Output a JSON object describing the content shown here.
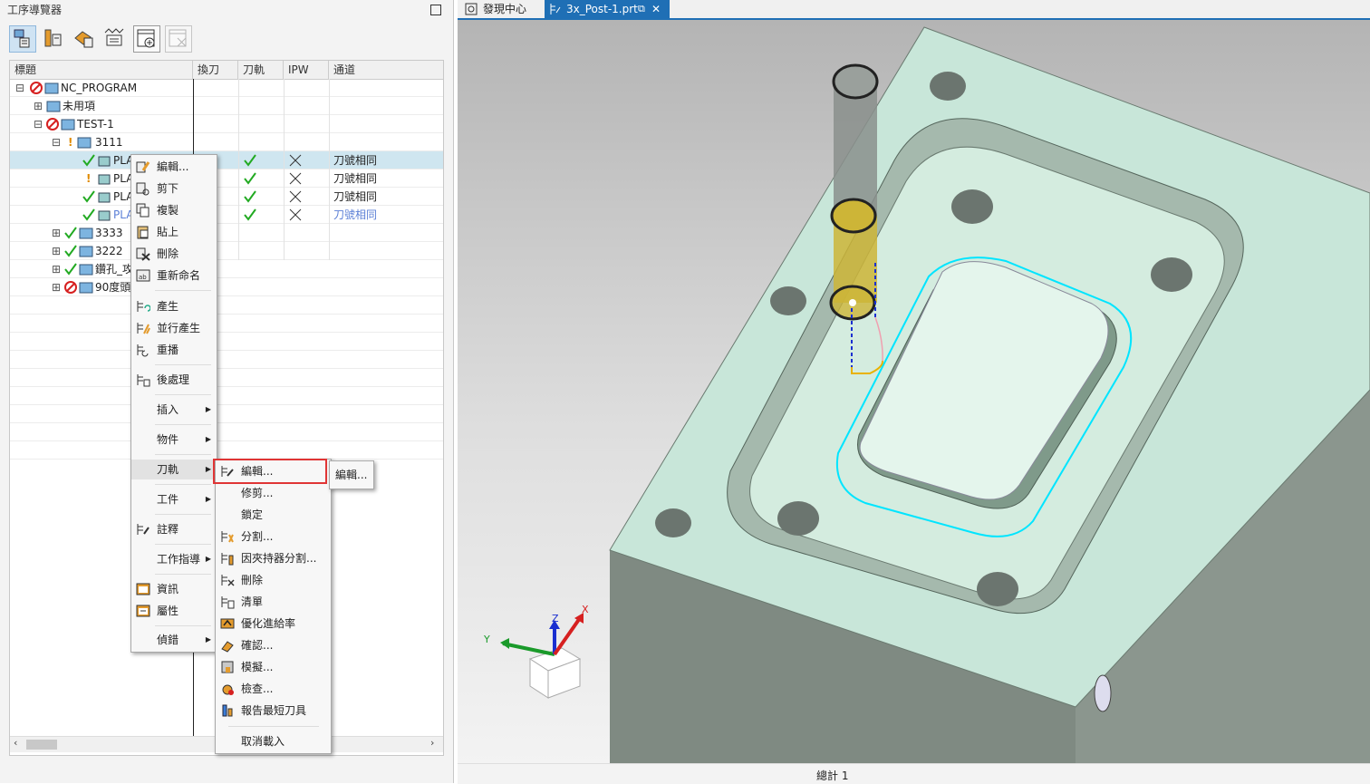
{
  "navigator": {
    "title": "工序導覽器",
    "toolbar_icons": [
      "program-order-view-icon",
      "machine-tool-view-icon",
      "geometry-view-icon",
      "method-view-icon",
      "add-view-icon",
      "remove-view-icon"
    ],
    "columns": [
      "標題",
      "換刀",
      "刀軌",
      "IPW",
      "通道"
    ],
    "rows": [
      {
        "label": "NC_PROGRAM",
        "ch": ""
      },
      {
        "label": "未用項",
        "ch": ""
      },
      {
        "label": "TEST-1",
        "ch": ""
      },
      {
        "label": "3111",
        "ch": ""
      },
      {
        "label": "PLA",
        "ch": "刀號相同"
      },
      {
        "label": "PLA",
        "ch": "刀號相同"
      },
      {
        "label": "PLA",
        "ch": "刀號相同"
      },
      {
        "label": "PLA",
        "ch": "刀號相同"
      },
      {
        "label": "3333",
        "ch": ""
      },
      {
        "label": "3222",
        "ch": ""
      },
      {
        "label": "鑽孔_攻",
        "ch": ""
      },
      {
        "label": "90度頭",
        "ch": ""
      }
    ]
  },
  "context_menu": {
    "items": [
      "編輯...",
      "剪下",
      "複製",
      "貼上",
      "刪除",
      "重新命名",
      "產生",
      "並行產生",
      "重播",
      "後處理",
      "插入",
      "物件",
      "刀軌",
      "工件",
      "註釋",
      "工作指導",
      "資訊",
      "屬性",
      "偵錯"
    ]
  },
  "toolpath_submenu": {
    "items": [
      "編輯...",
      "修剪...",
      "鎖定",
      "分割...",
      "因夾持器分割...",
      "刪除",
      "清單",
      "優化進給率",
      "確認...",
      "模擬...",
      "檢查...",
      "報告最短刀具",
      "取消載入"
    ]
  },
  "tooltip_menu": {
    "item": "編輯..."
  },
  "tabs": [
    {
      "label": "發現中心",
      "active": false
    },
    {
      "label": "3x_Post-1.prt",
      "active": true
    }
  ],
  "axes": {
    "x": "X",
    "y": "Y",
    "z": "Z"
  },
  "status": {
    "text": "總計 1"
  },
  "colors": {
    "accent": "#1f6fb5",
    "check": "#22aa22",
    "highlight_box": "#e03535",
    "toolpath": "#00e5ff",
    "channel_link": "#5b7fd6"
  }
}
